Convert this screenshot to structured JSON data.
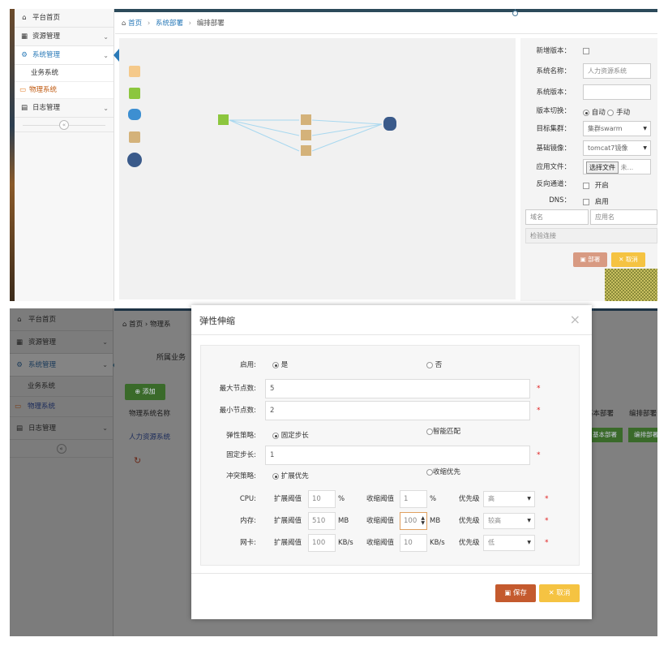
{
  "sidebar": {
    "items": [
      {
        "label": "平台首页",
        "icon": "home-icon"
      },
      {
        "label": "资源管理",
        "icon": "grid-icon"
      },
      {
        "label": "系统管理",
        "icon": "gears-icon"
      },
      {
        "label": "业务系统"
      },
      {
        "label": "物理系统",
        "icon": "folder-icon"
      },
      {
        "label": "日志管理",
        "icon": "book-icon"
      }
    ],
    "collapse_glyph": "«"
  },
  "breadcrumb": {
    "home": "首页",
    "level2": "系统部署",
    "current": "编排部署",
    "current2": "物理系"
  },
  "deploy_form": {
    "new_version_label": "新增版本：",
    "system_name_label": "系统名称：",
    "system_name_value": "人力资源系统",
    "system_version_label": "系统版本：",
    "version_switch_label": "版本切换：",
    "switch_auto": "自动",
    "switch_manual": "手动",
    "cluster_label": "目标集群：",
    "cluster_value": "集群swarm",
    "image_label": "基础镜像：",
    "image_value": "tomcat7镜像",
    "app_file_label": "应用文件：",
    "file_button": "选择文件",
    "file_status": "未...",
    "reverse_label": "反向通道：",
    "reverse_option": "开启",
    "dns_label": "DNS：",
    "dns_option": "启用",
    "domain_placeholder": "域名",
    "app_name_placeholder": "应用名",
    "verify_placeholder": "检验连接",
    "deploy_button": "部署",
    "cancel_button": "取消"
  },
  "background_page": {
    "section_label": "所属业务",
    "add_button": "添加",
    "col_name": "物理系统名称",
    "row_name": "人力资源系统",
    "col_basic_deploy": "基本部署",
    "col_orchestrate": "编排部署",
    "btn_basic_deploy": "基本部署",
    "btn_orchestrate": "编排部署"
  },
  "modal": {
    "title": "弹性伸缩",
    "close_glyph": "×",
    "enable_label": "启用:",
    "enable_yes": "是",
    "enable_no": "否",
    "max_nodes_label": "最大节点数:",
    "max_nodes_value": "5",
    "min_nodes_label": "最小节点数:",
    "min_nodes_value": "2",
    "policy_label": "弹性策略:",
    "policy_fixed": "固定步长",
    "policy_smart": "智能匹配",
    "step_label": "固定步长:",
    "step_value": "1",
    "conflict_label": "冲突策略:",
    "conflict_expand": "扩展优先",
    "conflict_shrink": "收缩优先",
    "required_mark": "*",
    "expand_threshold_label": "扩展阈值",
    "shrink_threshold_label": "收缩阈值",
    "priority_label": "优先级",
    "resources": [
      {
        "name": "CPU:",
        "expand": "10",
        "expand_unit": "%",
        "shrink": "1",
        "shrink_unit": "%",
        "priority": "高"
      },
      {
        "name": "内存:",
        "expand": "510",
        "expand_unit": "MB",
        "shrink": "100",
        "shrink_unit": "MB",
        "priority": "较高"
      },
      {
        "name": "网卡:",
        "expand": "100",
        "expand_unit": "KB/s",
        "shrink": "10",
        "shrink_unit": "KB/s",
        "priority": "低"
      }
    ],
    "save_button": "保存",
    "cancel_button": "取消"
  },
  "colors": {
    "link_blue": "#2a7ab8",
    "deploy_btn": "#d89a82",
    "cancel_yellow": "#f5c342",
    "save_red": "#c45a2e",
    "required_red": "#e02020"
  }
}
